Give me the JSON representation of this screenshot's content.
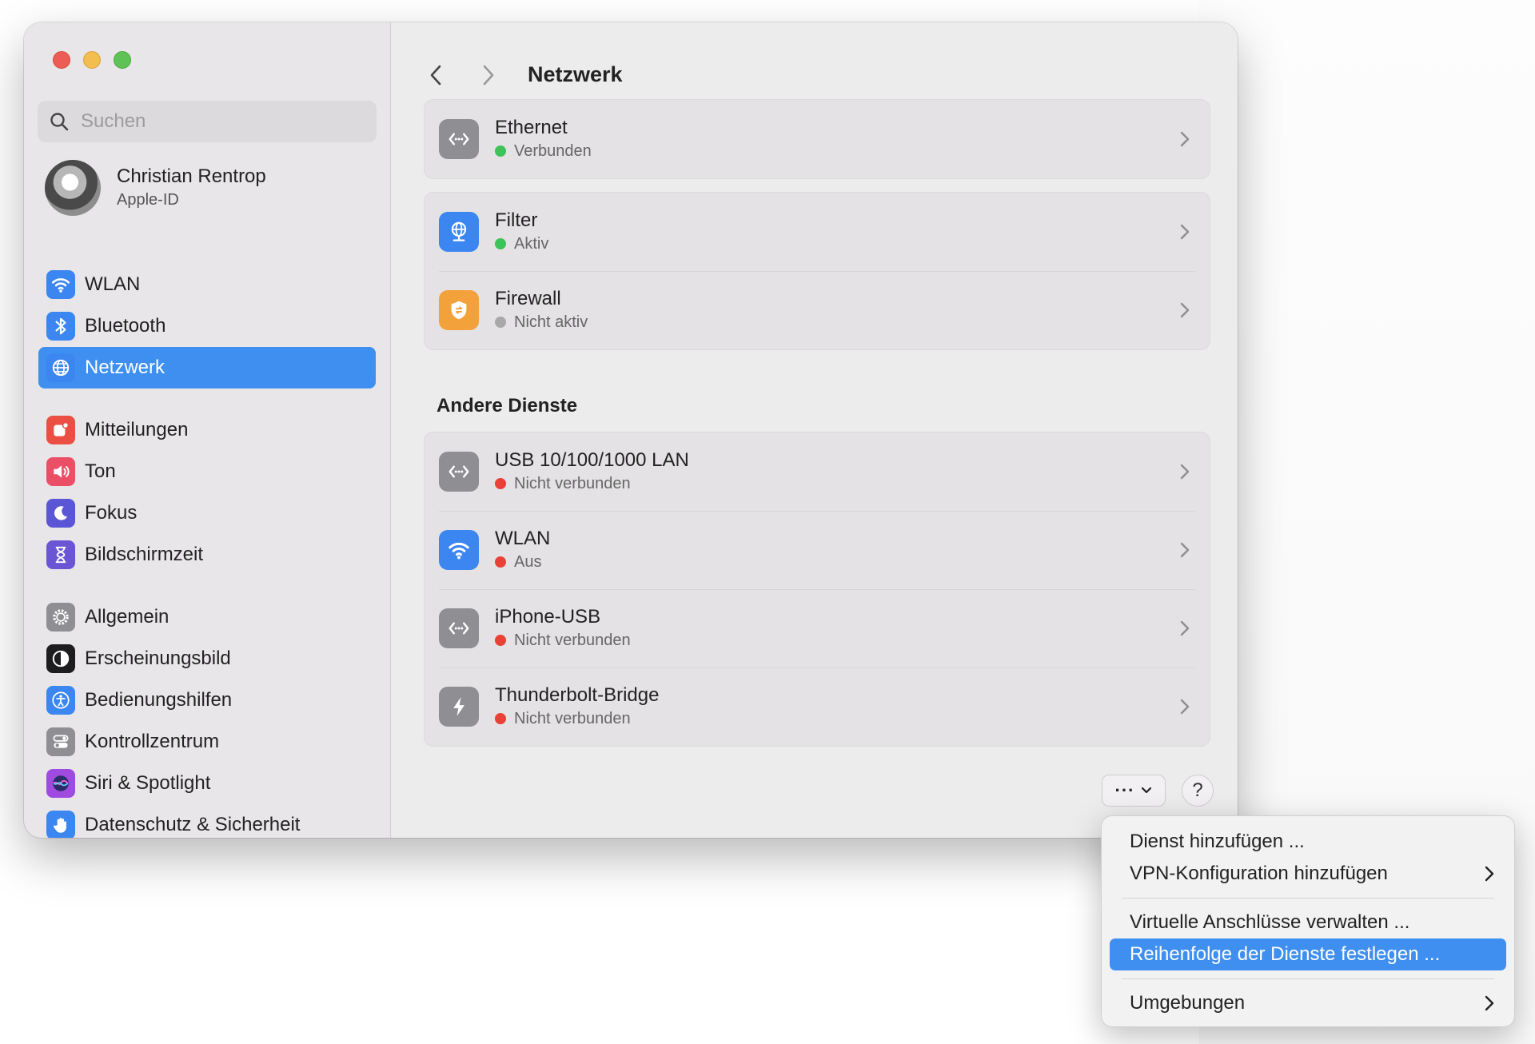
{
  "window": {
    "title": "Netzwerk"
  },
  "search": {
    "placeholder": "Suchen"
  },
  "profile": {
    "name": "Christian Rentrop",
    "subtitle": "Apple-ID"
  },
  "sidebar": {
    "groups": [
      [
        {
          "label": "WLAN",
          "icon": "wifi-icon",
          "color": "#3b86f0"
        },
        {
          "label": "Bluetooth",
          "icon": "bluetooth-icon",
          "color": "#3b86f0"
        },
        {
          "label": "Netzwerk",
          "icon": "globe-icon",
          "color": "#3b86f0",
          "active": true
        }
      ],
      [
        {
          "label": "Mitteilungen",
          "icon": "bell-icon",
          "color": "#eb4f43"
        },
        {
          "label": "Ton",
          "icon": "speaker-icon",
          "color": "#eb4f66"
        },
        {
          "label": "Fokus",
          "icon": "moon-icon",
          "color": "#5a56d6"
        },
        {
          "label": "Bildschirmzeit",
          "icon": "hourglass-icon",
          "color": "#6a55d4"
        }
      ],
      [
        {
          "label": "Allgemein",
          "icon": "gear-icon",
          "color": "#8e8e93"
        },
        {
          "label": "Erscheinungsbild",
          "icon": "appearance-icon",
          "color": "#1d1d1f"
        },
        {
          "label": "Bedienungshilfen",
          "icon": "accessibility-icon",
          "color": "#3b86f0"
        },
        {
          "label": "Kontrollzentrum",
          "icon": "toggles-icon",
          "color": "#8e8e93"
        },
        {
          "label": "Siri & Spotlight",
          "icon": "siri-icon",
          "color": "#a04be0"
        },
        {
          "label": "Datenschutz & Sicherheit",
          "icon": "hand-icon",
          "color": "#3b86f0"
        }
      ]
    ]
  },
  "main": {
    "services": [
      {
        "title": "Ethernet",
        "status": "Verbunden",
        "status_color": "#3ec25a",
        "icon": "ethernet-icon"
      }
    ],
    "filters": [
      {
        "title": "Filter",
        "status": "Aktiv",
        "status_color": "#3ec25a",
        "icon": "filter-globe-icon"
      },
      {
        "title": "Firewall",
        "status": "Nicht aktiv",
        "status_color": "#a8a8a8",
        "icon": "firewall-shield-icon"
      }
    ],
    "other_services_title": "Andere Dienste",
    "other_services": [
      {
        "title": "USB 10/100/1000 LAN",
        "status": "Nicht verbunden",
        "status_color": "#e94136",
        "icon": "ethernet-icon"
      },
      {
        "title": "WLAN",
        "status": "Aus",
        "status_color": "#e94136",
        "icon": "wifi-icon"
      },
      {
        "title": "iPhone-USB",
        "status": "Nicht verbunden",
        "status_color": "#e94136",
        "icon": "ethernet-icon"
      },
      {
        "title": "Thunderbolt-Bridge",
        "status": "Nicht verbunden",
        "status_color": "#e94136",
        "icon": "thunderbolt-icon"
      }
    ],
    "actions_button": "···",
    "help_button": "?"
  },
  "menu": {
    "items": [
      {
        "label": "Dienst hinzufügen ...",
        "submenu": false
      },
      {
        "label": "VPN-Konfiguration hinzufügen",
        "submenu": true
      },
      {
        "label": "Virtuelle Anschlüsse verwalten ...",
        "submenu": false
      },
      {
        "label": "Reihenfolge der Dienste festlegen ...",
        "submenu": false,
        "highlighted": true
      },
      {
        "label": "Umgebungen",
        "submenu": true
      }
    ],
    "accent_color": "#3f8ff0"
  }
}
